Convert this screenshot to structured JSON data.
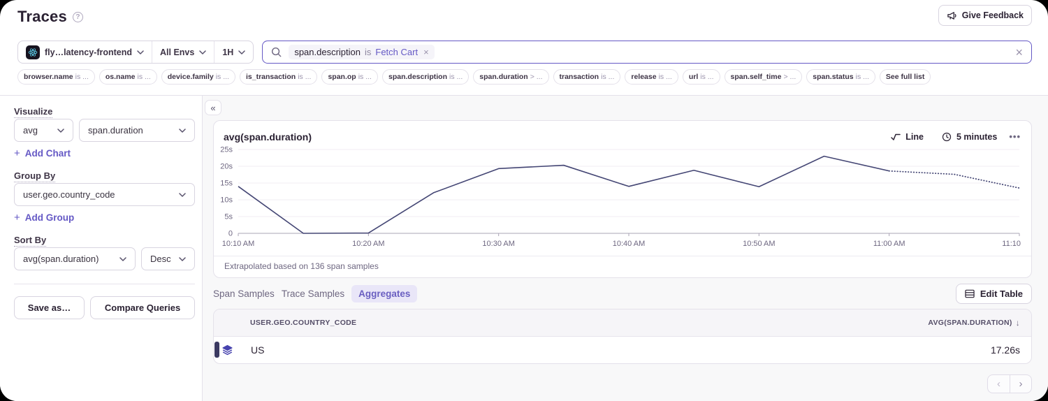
{
  "header": {
    "title": "Traces",
    "feedback_button": "Give Feedback"
  },
  "filters": {
    "project": "fly…latency-frontend",
    "environment": "All Envs",
    "period": "1H",
    "search": {
      "token": {
        "key": "span.description",
        "op": "is",
        "value": "Fetch Cart"
      }
    }
  },
  "chips": [
    {
      "key": "browser.name",
      "rest": "is ..."
    },
    {
      "key": "os.name",
      "rest": "is ..."
    },
    {
      "key": "device.family",
      "rest": "is ..."
    },
    {
      "key": "is_transaction",
      "rest": "is ..."
    },
    {
      "key": "span.op",
      "rest": "is ..."
    },
    {
      "key": "span.description",
      "rest": "is ..."
    },
    {
      "key": "span.duration",
      "rest": "> ..."
    },
    {
      "key": "transaction",
      "rest": "is ..."
    },
    {
      "key": "release",
      "rest": "is ..."
    },
    {
      "key": "url",
      "rest": "is ..."
    },
    {
      "key": "span.self_time",
      "rest": "> ..."
    },
    {
      "key": "span.status",
      "rest": "is ..."
    },
    {
      "key": "See full list",
      "rest": ""
    }
  ],
  "sidebar": {
    "visualize": {
      "label": "Visualize",
      "agg": "avg",
      "field": "span.duration",
      "add": "Add Chart"
    },
    "group_by": {
      "label": "Group By",
      "value": "user.geo.country_code",
      "add": "Add Group"
    },
    "sort_by": {
      "label": "Sort By",
      "value": "avg(span.duration)",
      "direction": "Desc"
    },
    "save_as": "Save as…",
    "compare": "Compare Queries"
  },
  "main": {
    "collapse_glyph": "«",
    "tabs": [
      {
        "label": "Span Samples",
        "active": false
      },
      {
        "label": "Trace Samples",
        "active": false
      },
      {
        "label": "Aggregates",
        "active": true
      }
    ],
    "edit_table": "Edit Table"
  },
  "chart_data": {
    "type": "line",
    "title": "avg(span.duration)",
    "controls": {
      "type_label": "Line",
      "interval": "5 minutes"
    },
    "x_times": [
      "10:10",
      "10:15",
      "10:20",
      "10:25",
      "10:30",
      "10:35",
      "10:40",
      "10:45",
      "10:50",
      "10:55",
      "11:00",
      "11:05",
      "11:10"
    ],
    "values_seconds": [
      14.0,
      0,
      0.1,
      12.1,
      19.3,
      20.3,
      14.0,
      18.8,
      13.9,
      23.0,
      18.6,
      17.6,
      13.5
    ],
    "solid_until_index": 10,
    "x_tick_labels": [
      "10:10 AM",
      "10:20 AM",
      "10:30 AM",
      "10:40 AM",
      "10:50 AM",
      "11:00 AM",
      "11:10"
    ],
    "y_ticks": [
      "25s",
      "20s",
      "15s",
      "10s",
      "5s",
      "0"
    ],
    "ylim": [
      0,
      25
    ],
    "grid": true,
    "footer": "Extrapolated based on 136 span samples",
    "line_color": "#444674"
  },
  "table": {
    "columns": {
      "country": "USER.GEO.COUNTRY_CODE",
      "avg": "AVG(SPAN.DURATION)"
    },
    "sort_arrow": "↓",
    "rows": [
      {
        "country": "US",
        "avg": "17.26s"
      }
    ]
  },
  "pagination": {
    "prev": "‹",
    "next": "›"
  },
  "colors": {
    "accent": "#6559c5",
    "line": "#444674",
    "row_accent": "#3b3961",
    "layers_icon": "#4743ae"
  }
}
